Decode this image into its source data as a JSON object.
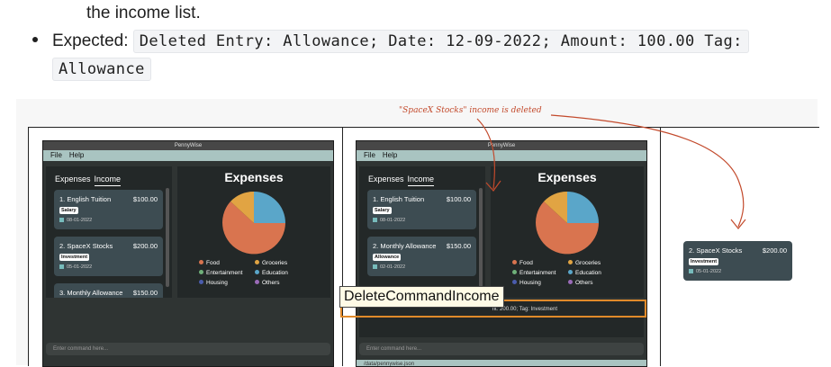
{
  "doc": {
    "line1": "the income list.",
    "bullet_label": "Expected:",
    "code_line1": "Deleted Entry: Allowance; Date: 12-09-2022; Amount: 100.00 Tag:",
    "code_line2": "Allowance"
  },
  "annotation": {
    "text": "\"SpaceX Stocks\" income is deleted"
  },
  "tooltip": {
    "text": "DeleteCommandIncome"
  },
  "window": {
    "title": "PennyWise",
    "menu": [
      "File",
      "Help"
    ],
    "tabs": [
      "Expenses",
      "Income"
    ],
    "chart_title": "Expenses",
    "command_placeholder": "Enter command here...",
    "legend": [
      "Food",
      "Groceries",
      "Entertainment",
      "Education",
      "Housing",
      "Others"
    ],
    "legend_colors": [
      "#d9744f",
      "#e1a443",
      "#6fb07a",
      "#5aa6c9",
      "#4a5cad",
      "#9a6bb8"
    ]
  },
  "left_cards": [
    {
      "title": "1. English Tuition",
      "amount": "$100.00",
      "tag": "Salary",
      "date": "08-01-2022"
    },
    {
      "title": "2. SpaceX Stocks",
      "amount": "$200.00",
      "tag": "Investment",
      "date": "05-01-2022"
    },
    {
      "title": "3. Monthly Allowance",
      "amount": "$150.00"
    }
  ],
  "middle_cards": [
    {
      "title": "1. English Tuition",
      "amount": "$100.00",
      "tag": "Salary",
      "date": "08-01-2022"
    },
    {
      "title": "2. Monthly Allowance",
      "amount": "$150.00",
      "tag": "Allowance",
      "date": "02-01-2022"
    }
  ],
  "middle_result": "nt: 200.00; Tag: Investment",
  "middle_status": "/data/pennywise.json",
  "right_card": {
    "title": "2. SpaceX Stocks",
    "amount": "$200.00",
    "tag": "Investment",
    "date": "05-01-2022"
  }
}
